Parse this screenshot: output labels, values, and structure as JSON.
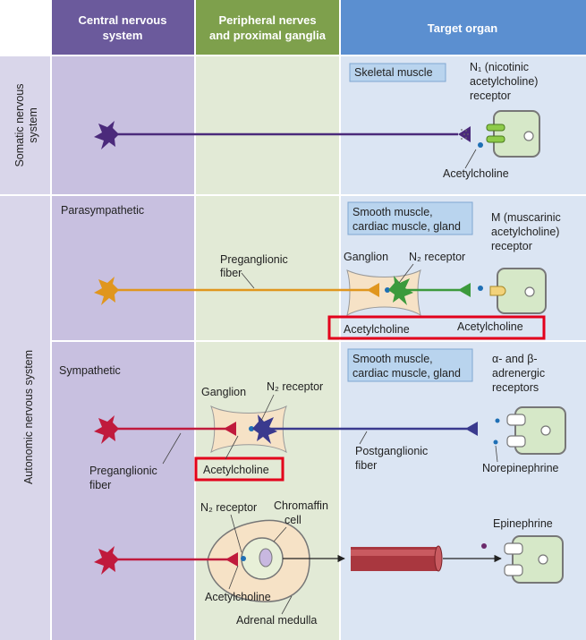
{
  "colors": {
    "header_cns": "#6b5a9c",
    "header_pns": "#7ea04c",
    "header_target": "#5b8fd0",
    "col_cns": "#c8c0e0",
    "col_pns": "#e2ead6",
    "col_target": "#dbe5f3",
    "side_label_bg": "#d9d6ea",
    "highlight_box": "#e3001b",
    "somatic_fiber": "#4b2a7b",
    "parasymp_pre_fiber": "#e0961e",
    "parasymp_post_fiber": "#3c9a3c",
    "symp_pre_fiber": "#c01a3c",
    "symp_post_fiber": "#3a3a8e",
    "organ_box": "#b9d4ee",
    "cell_fill": "#d6e8c8",
    "ganglion_fill": "#f6e2c6",
    "blood_vessel": "#a9373f"
  },
  "headers": {
    "cns": [
      "Central nervous",
      "system"
    ],
    "pns": [
      "Peripheral nerves",
      "and proximal ganglia"
    ],
    "target": "Target organ"
  },
  "side_labels": {
    "somatic": [
      "Somatic nervous",
      "system"
    ],
    "autonomic": "Autonomic nervous system"
  },
  "somatic": {
    "organ": "Skeletal muscle",
    "receptor": [
      "N₁ (nicotinic",
      "acetylcholine)",
      "receptor"
    ],
    "transmitter": "Acetylcholine"
  },
  "parasympathetic": {
    "title": "Parasympathetic",
    "organ": [
      "Smooth muscle,",
      "cardiac muscle, gland"
    ],
    "receptor": [
      "M (muscarinic",
      "acetylcholine)",
      "receptor"
    ],
    "preganglionic": [
      "Preganglionic",
      "fiber"
    ],
    "ganglion": "Ganglion",
    "ganglion_receptor": "N₂ receptor",
    "ganglion_transmitter": "Acetylcholine",
    "target_transmitter": "Acetylcholine"
  },
  "sympathetic": {
    "title": "Sympathetic",
    "organ": [
      "Smooth muscle,",
      "cardiac muscle, gland"
    ],
    "receptor": [
      "α- and β-",
      "adrenergic",
      "receptors"
    ],
    "ganglion": "Ganglion",
    "ganglion_receptor": "N₂ receptor",
    "preganglionic": [
      "Preganglionic",
      "fiber"
    ],
    "ganglion_transmitter": "Acetylcholine",
    "postganglionic": [
      "Postganglionic",
      "fiber"
    ],
    "target_transmitter": "Norepinephrine"
  },
  "adrenal": {
    "receptor": "N₂ receptor",
    "chromaffin": [
      "Chromaffin",
      "cell"
    ],
    "transmitter": "Acetylcholine",
    "medulla": "Adrenal medulla",
    "hormone": "Epinephrine"
  }
}
